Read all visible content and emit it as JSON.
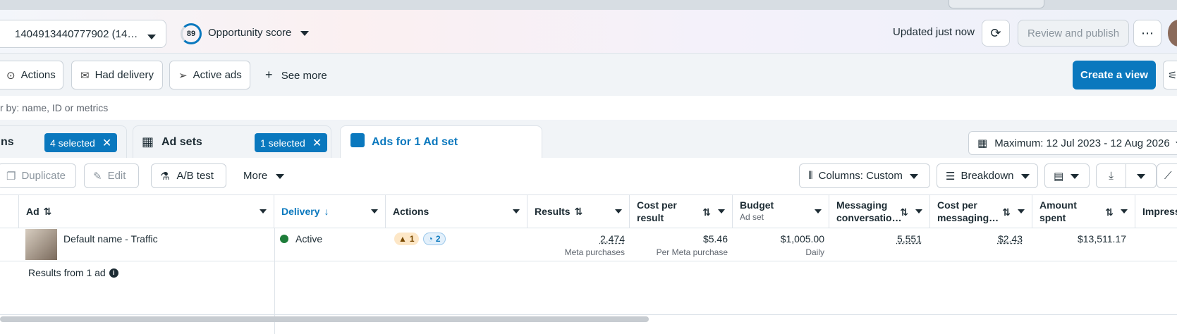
{
  "header": {
    "account": "1404913440777902 (14…",
    "opportunity_score": "89",
    "opportunity_label": "Opportunity score",
    "updated": "Updated just now",
    "review_publish": "Review and publish"
  },
  "filters": {
    "actions": "Actions",
    "had_delivery": "Had delivery",
    "active_ads": "Active ads",
    "see_more": "See more",
    "create_view": "Create a view"
  },
  "search": {
    "placeholder": "r by: name, ID or metrics"
  },
  "tabs": {
    "campaigns_label": "ns",
    "campaigns_selected": "4 selected",
    "adsets_label": "Ad sets",
    "adsets_selected": "1 selected",
    "ads_label": "Ads for 1 Ad set"
  },
  "date_range": "Maximum: 12 Jul 2023 - 12 Aug 2026",
  "toolbar": {
    "duplicate": "Duplicate",
    "edit": "Edit",
    "ab_test": "A/B test",
    "more": "More",
    "columns": "Columns: Custom",
    "breakdown": "Breakdown"
  },
  "table": {
    "headers": {
      "ad": "Ad",
      "delivery": "Delivery",
      "actions": "Actions",
      "results": "Results",
      "cost_per_result": [
        "Cost per",
        "result"
      ],
      "budget": "Budget",
      "budget_sub": "Ad set",
      "messaging": [
        "Messaging",
        "conversatio…"
      ],
      "cost_per_messaging": [
        "Cost per",
        "messaging…"
      ],
      "amount_spent": [
        "Amount",
        "spent"
      ],
      "impressions": "Impress"
    },
    "row": {
      "name": "Default name - Traffic",
      "delivery": "Active",
      "warn_count": "1",
      "info_count": "2",
      "results": "2,474",
      "results_sub": "Meta purchases",
      "cost_per_result": "$5.46",
      "cost_per_result_sub": "Per Meta purchase",
      "budget": "$1,005.00",
      "budget_sub": "Daily",
      "messaging": "5,551",
      "cost_per_messaging": "$2.43",
      "amount_spent": "$13,511.17"
    },
    "footer": "Results from 1 ad"
  },
  "colors": {
    "accent": "#0a78be",
    "active": "#1e7d3a",
    "warn": "#f5a623"
  }
}
